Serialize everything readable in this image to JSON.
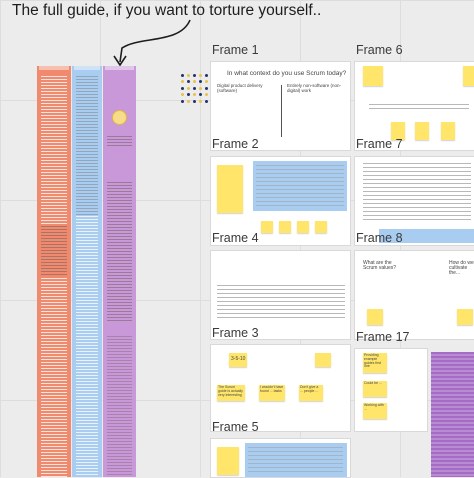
{
  "canvas": {
    "annotation_text": "The full guide, if you want to torture yourself.."
  },
  "frames": [
    {
      "id": "frame-1",
      "label": "Frame 1"
    },
    {
      "id": "frame-6",
      "label": "Frame 6"
    },
    {
      "id": "frame-2",
      "label": "Frame 2"
    },
    {
      "id": "frame-7",
      "label": "Frame 7"
    },
    {
      "id": "frame-4",
      "label": "Frame 4"
    },
    {
      "id": "frame-8",
      "label": "Frame 8"
    },
    {
      "id": "frame-17",
      "label": "Frame 17"
    },
    {
      "id": "frame-3",
      "label": "Frame 3"
    },
    {
      "id": "frame-5",
      "label": "Frame 5"
    }
  ],
  "frame1": {
    "question": "In what context do you use Scrum today?",
    "option_left": "Digital product delivery (software)",
    "option_right": "Entirely non-software (non-digital) work"
  },
  "frame8": {
    "question_left": "What are the Scrum values?",
    "question_right": "How do we cultivate the..."
  },
  "frame3": {
    "sticky_small": "3-5-10",
    "sticky_left": "The Scrum guide is actually very interesting",
    "sticky_mid": "I wouldn't have found ... tasks",
    "sticky_right": "Don't give a ... people ..."
  },
  "frame17_right": {
    "sticky_top": "Providing example guides first one",
    "sticky_mid": "Could be ...",
    "sticky_bottom": "Working with ..."
  },
  "colors": {
    "column_red": "#ef8a6e",
    "column_blue": "#a8cdf0",
    "column_purple": "#c898d8",
    "sticky_yellow": "#ffe66b",
    "frame_blue_box": "#a9cdf1"
  }
}
